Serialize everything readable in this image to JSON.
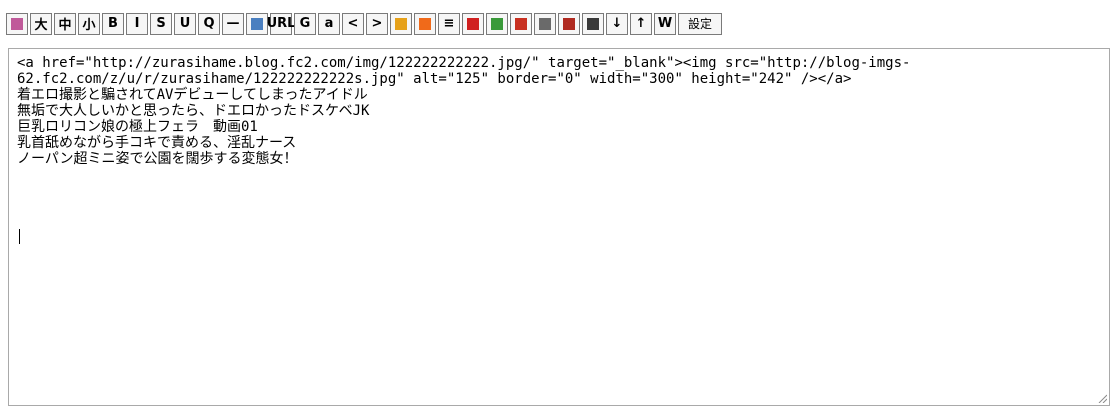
{
  "toolbar": {
    "buttons": [
      {
        "name": "palette-icon",
        "label": "",
        "color": "#c05a9a"
      },
      {
        "name": "font-large-button",
        "label": "大"
      },
      {
        "name": "font-medium-button",
        "label": "中"
      },
      {
        "name": "font-small-button",
        "label": "小"
      },
      {
        "name": "bold-button",
        "label": "B"
      },
      {
        "name": "italic-button",
        "label": "I"
      },
      {
        "name": "strikethrough-button",
        "label": "S"
      },
      {
        "name": "underline-button",
        "label": "U"
      },
      {
        "name": "quote-button",
        "label": "Q"
      },
      {
        "name": "horizontal-rule-button",
        "label": "—"
      },
      {
        "name": "image-icon",
        "label": "",
        "color": "#4a7fc0"
      },
      {
        "name": "url-button",
        "label": "URL"
      },
      {
        "name": "google-icon",
        "label": "G"
      },
      {
        "name": "amazon-icon",
        "label": "a"
      },
      {
        "name": "chevron-left-icon",
        "label": "<"
      },
      {
        "name": "chevron-right-icon",
        "label": ">"
      },
      {
        "name": "list-icon",
        "label": "",
        "color": "#e6a11a"
      },
      {
        "name": "blog-icon",
        "label": "",
        "color": "#f06a1a"
      },
      {
        "name": "align-icon",
        "label": "≡"
      },
      {
        "name": "pencil-icon",
        "label": "",
        "color": "#d02020"
      },
      {
        "name": "check-pencil-icon",
        "label": "",
        "color": "#3a9a3a"
      },
      {
        "name": "feed-icon",
        "label": "",
        "color": "#c83020"
      },
      {
        "name": "tv-icon",
        "label": "",
        "color": "#6a6a6a"
      },
      {
        "name": "youtube-icon",
        "label": "",
        "color": "#b02a20"
      },
      {
        "name": "camera-icon",
        "label": "",
        "color": "#3a3a3a"
      },
      {
        "name": "arrow-down-icon",
        "label": "↓"
      },
      {
        "name": "arrow-up-icon",
        "label": "↑"
      },
      {
        "name": "wikipedia-icon",
        "label": "W"
      },
      {
        "name": "settings-button",
        "label": "設定"
      }
    ]
  },
  "editor": {
    "lines": [
      "<a href=\"http://zurasihame.blog.fc2.com/img/122222222222.jpg/\" target=\"_blank\"><img src=\"http://blog-imgs-",
      "62.fc2.com/z/u/r/zurasihame/122222222222s.jpg\" alt=\"125\" border=\"0\" width=\"300\" height=\"242\" /></a>",
      "着エロ撮影と騙されてAVデビューしてしまったアイドル",
      "無垢で大人しいかと思ったら、ドエロかったドスケベJK",
      "巨乳ロリコン娘の極上フェラ　動画01",
      "乳首舐めながら手コキで責める、淫乱ナース",
      "ノーパン超ミニ姿で公園を闊歩する変態女！"
    ]
  }
}
